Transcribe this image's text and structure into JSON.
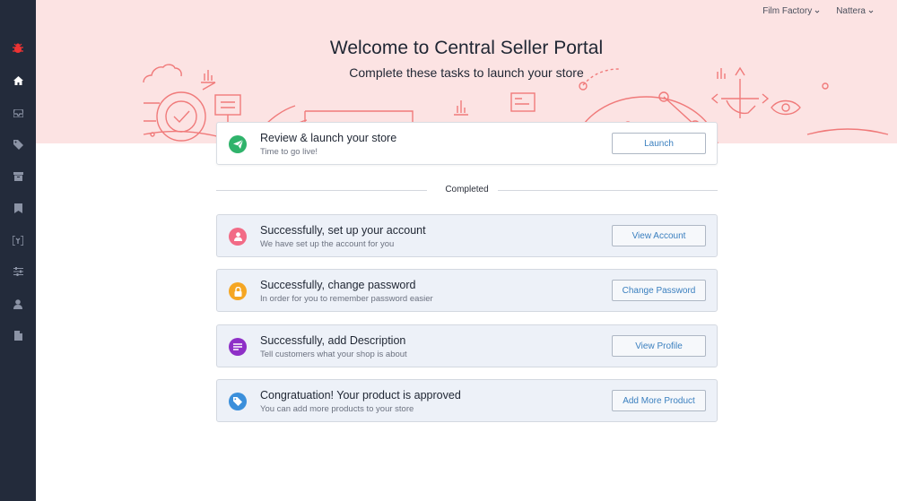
{
  "topnav": {
    "store": "Film Factory",
    "user": "Nattera"
  },
  "hero": {
    "title": "Welcome to Central Seller Portal",
    "subtitle": "Complete these tasks to launch your store"
  },
  "sidebar": {
    "items": [
      {
        "icon": "bug-logo-icon"
      },
      {
        "icon": "home-icon"
      },
      {
        "icon": "inbox-icon"
      },
      {
        "icon": "tag-icon"
      },
      {
        "icon": "archive-icon"
      },
      {
        "icon": "bookmark-icon"
      },
      {
        "icon": "brackets-icon"
      },
      {
        "icon": "sliders-icon"
      },
      {
        "icon": "user-icon"
      },
      {
        "icon": "document-icon"
      }
    ]
  },
  "launch_task": {
    "title": "Review & launch your store",
    "subtitle": "Time to go live!",
    "button": "Launch",
    "icon": "send-icon",
    "color": "#2fb36b"
  },
  "completed_label": "Completed",
  "completed_tasks": [
    {
      "title": "Successfully, set up your account",
      "subtitle": "We have set up the account for you",
      "button": "View Account",
      "icon": "user-icon",
      "color": "#f26b86"
    },
    {
      "title": "Successfully, change password",
      "subtitle": "In order for you to remember password easier",
      "button": "Change Password",
      "icon": "lock-icon",
      "color": "#f5a623"
    },
    {
      "title": "Successfully, add Description",
      "subtitle": "Tell customers what your shop is about",
      "button": "View Profile",
      "icon": "list-icon",
      "color": "#8e2fc7"
    },
    {
      "title": "Congratuation! Your product is approved",
      "subtitle": "You can add more products to your store",
      "button": "Add More Product",
      "icon": "tag-icon",
      "color": "#3b8fdb"
    }
  ]
}
